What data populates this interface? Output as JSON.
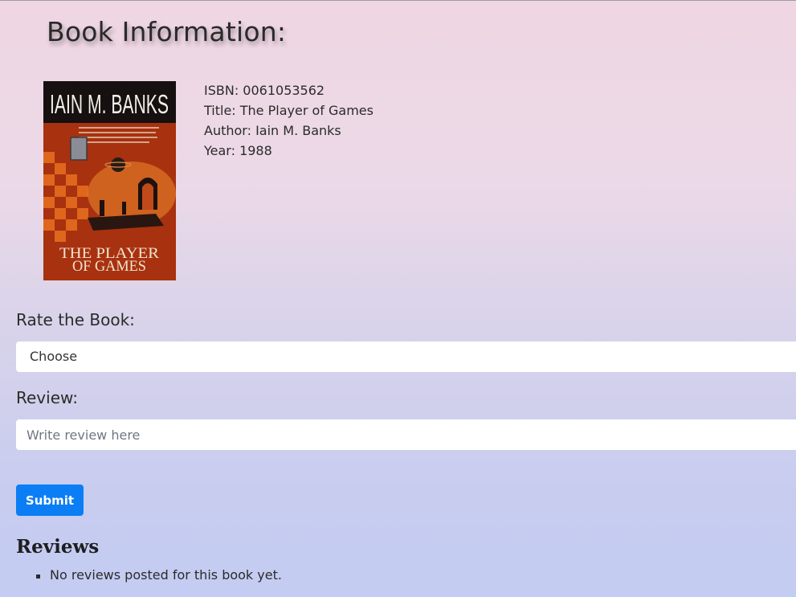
{
  "page": {
    "title": "Book Information:"
  },
  "book": {
    "cover": {
      "author_text": "IAIN M. BANKS",
      "title_line1": "THE PLAYER",
      "title_line2": "OF GAMES"
    },
    "isbn_line": "ISBN: 0061053562",
    "title_line": "Title: The Player of Games",
    "author_line": "Author: Iain M. Banks",
    "year_line": "Year: 1988"
  },
  "form": {
    "rate_label": "Rate the Book:",
    "rate_selected": "Choose",
    "review_label": "Review:",
    "review_placeholder": "Write review here",
    "review_value": "",
    "submit_label": "Submit"
  },
  "reviews": {
    "heading": "Reviews",
    "empty_text": "No reviews posted for this book yet."
  },
  "colors": {
    "accent": "#0b7df5",
    "cover_red": "#b83a12"
  }
}
